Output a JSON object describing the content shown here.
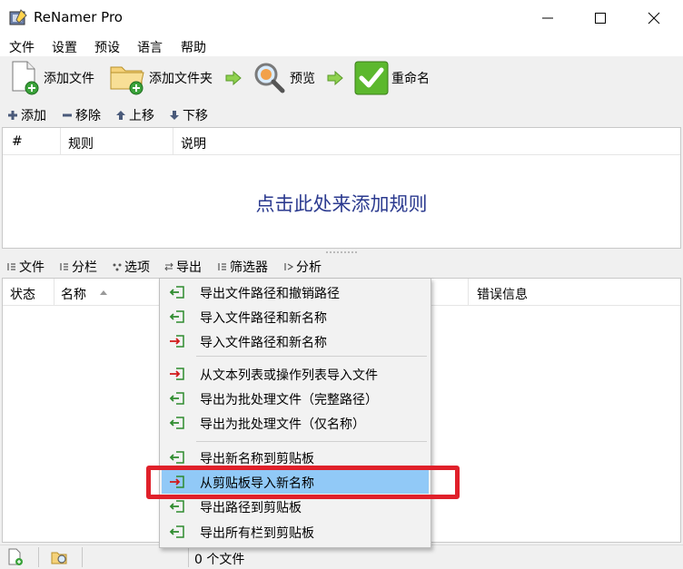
{
  "window": {
    "title": "ReNamer Pro"
  },
  "menu": [
    "文件",
    "设置",
    "预设",
    "语言",
    "帮助"
  ],
  "toolbar": {
    "add_files": "添加文件",
    "add_folders": "添加文件夹",
    "preview": "预览",
    "rename": "重命名"
  },
  "rules_toolbar": {
    "add": "添加",
    "remove": "移除",
    "up": "上移",
    "down": "下移"
  },
  "rules_table": {
    "columns": [
      "#",
      "规则",
      "说明"
    ],
    "empty_hint": "点击此处来添加规则"
  },
  "files_toolbar": {
    "files": "文件",
    "columns": "分栏",
    "options": "选项",
    "export": "导出",
    "filters": "筛选器",
    "analyze": "分析"
  },
  "files_table": {
    "columns": [
      "状态",
      "名称",
      "错误信息"
    ]
  },
  "export_menu": {
    "items": [
      {
        "label": "导出文件路径和撤销路径",
        "icon": "export-green-icon"
      },
      {
        "label": "导入文件路径和新名称",
        "icon": "export-green-icon"
      },
      {
        "label": "导入文件路径和新名称",
        "icon": "import-red-icon"
      },
      {
        "label": "从文本列表或操作列表导入文件",
        "icon": "import-red-icon"
      },
      {
        "label": "导出为批处理文件（完整路径）",
        "icon": "export-green-icon"
      },
      {
        "label": "导出为批处理文件（仅名称）",
        "icon": "export-green-icon"
      },
      {
        "label": "导出新名称到剪贴板",
        "icon": "export-green-icon"
      },
      {
        "label": "从剪贴板导入新名称",
        "icon": "import-red-icon"
      },
      {
        "label": "导出路径到剪贴板",
        "icon": "export-green-icon"
      },
      {
        "label": "导出所有栏到剪贴板",
        "icon": "export-green-icon"
      }
    ],
    "highlighted": "从剪贴板导入新名称"
  },
  "status": {
    "file_count": "0 个文件"
  },
  "colors": {
    "accent_highlight": "#91c9f7",
    "annotation_red": "#e0202a",
    "hint_blue": "#2b3a8f",
    "icon_green": "#2e8b2e",
    "icon_red": "#d11a1a"
  }
}
